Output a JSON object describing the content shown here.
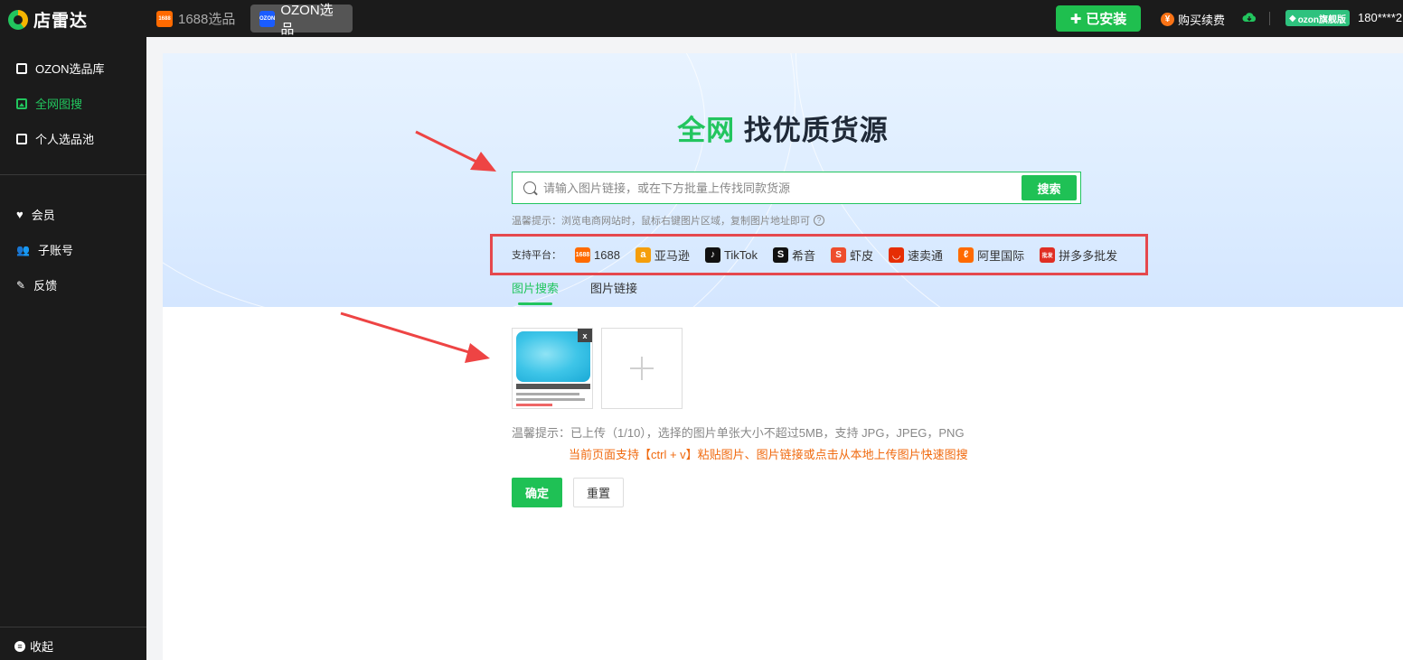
{
  "topbar": {
    "app_name": "店雷达",
    "tabs": [
      {
        "label": "1688选品",
        "badge": "1688"
      },
      {
        "label": "OZON选品",
        "badge": "OZON"
      }
    ],
    "installed_label": "已安装",
    "buy_renew_label": "购买续费",
    "vip_label": "ozon旗舰版",
    "user_phone": "180****2"
  },
  "sidebar": {
    "items": [
      {
        "label": "OZON选品库",
        "icon": "list-icon"
      },
      {
        "label": "全网图搜",
        "icon": "image-icon",
        "active": true
      },
      {
        "label": "个人选品池",
        "icon": "folder-icon"
      }
    ],
    "items2": [
      {
        "label": "会员",
        "icon": "heart-icon"
      },
      {
        "label": "子账号",
        "icon": "users-icon"
      },
      {
        "label": "反馈",
        "icon": "edit-icon"
      }
    ],
    "collapse_label": "收起"
  },
  "hero": {
    "title_highlight": "全网",
    "title_rest": " 找优质货源",
    "search_placeholder": "请输入图片链接，或在下方批量上传找同款货源",
    "search_button": "搜索",
    "tip": "温馨提示：浏览电商网站时，鼠标右键图片区域，复制图片地址即可",
    "platforms_label": "支持平台：",
    "platforms": [
      {
        "name": "1688",
        "icon_text": "1688",
        "color": "#ff6a00"
      },
      {
        "name": "亚马逊",
        "icon_text": "a",
        "color": "#f59e0b"
      },
      {
        "name": "TikTok",
        "icon_text": "♪",
        "color": "#111111"
      },
      {
        "name": "希音",
        "icon_text": "S",
        "color": "#111111"
      },
      {
        "name": "虾皮",
        "icon_text": "S",
        "color": "#ee4d2d"
      },
      {
        "name": "速卖通",
        "icon_text": "◡",
        "color": "#e62e04"
      },
      {
        "name": "阿里国际",
        "icon_text": "ℓ",
        "color": "#ff6a00"
      },
      {
        "name": "拼多多批发",
        "icon_text": "批发",
        "color": "#e02e24"
      }
    ]
  },
  "tabs": [
    {
      "label": "图片搜索",
      "active": true
    },
    {
      "label": "图片链接",
      "active": false
    }
  ],
  "upload": {
    "close_label": "x",
    "tip": "温馨提示：已上传（1/10），选择的图片单张大小不超过5MB，支持 JPG，JPEG，PNG",
    "paste_tip": "当前页面支持【ctrl + v】粘贴图片、图片链接或点击从本地上传图片快速图搜",
    "confirm_label": "确定",
    "reset_label": "重置"
  },
  "colors": {
    "accent": "#22c55e",
    "highlight_border": "#e5484d",
    "warning_text": "#f06a0f"
  }
}
